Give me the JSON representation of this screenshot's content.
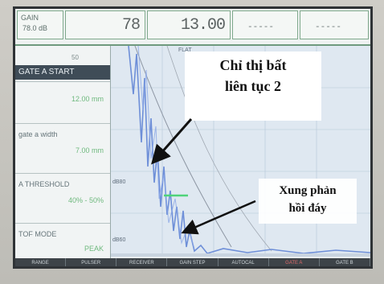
{
  "header": {
    "gain_label": "GAIN",
    "gain_value": "78.0 dB",
    "reading_1": "78",
    "reading_2": "13.00",
    "reading_3": "-----",
    "reading_4": "-----"
  },
  "left_panel": {
    "top_label": "50",
    "selected_item": "GATE A START",
    "items": [
      {
        "label": "",
        "value": "12.00 mm"
      },
      {
        "label": "gate a width",
        "value": "7.00 mm"
      },
      {
        "label": "A THRESHOLD",
        "value": "40% - 50%"
      },
      {
        "label": "TOF MODE",
        "value": "PEAK"
      }
    ]
  },
  "scope": {
    "label_top": "FLAT",
    "label_mid": "dB80",
    "label_low": "dB60",
    "colors": {
      "trace": "#6e8fd8",
      "gate": "#4fd37a",
      "grid": "#b6c6d8"
    }
  },
  "annotations": {
    "callout_1_line_1": "Chỉ thị bất",
    "callout_1_line_2": "liên tục 2",
    "callout_2_line_1": "Xung phản",
    "callout_2_line_2": "hồi đáy"
  },
  "footer": {
    "keys": [
      "RANGE",
      "PULSER",
      "RECEIVER",
      "GAIN STEP",
      "AUTOCAL",
      "GATE A",
      "GATE B"
    ]
  }
}
